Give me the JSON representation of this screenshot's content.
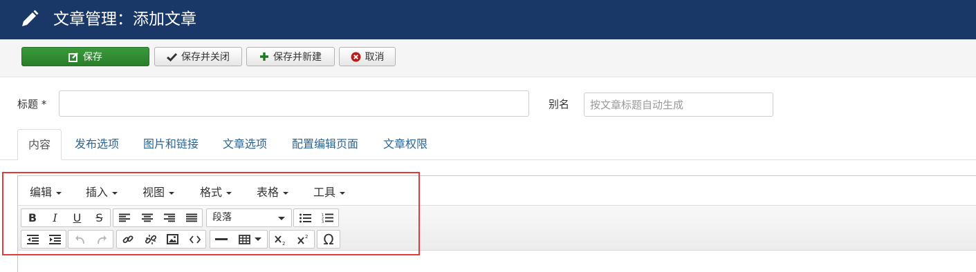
{
  "header": {
    "title": "文章管理：添加文章"
  },
  "toolbar": {
    "save": "保存",
    "save_close": "保存并关闭",
    "save_new": "保存并新建",
    "cancel": "取消"
  },
  "form": {
    "title_label": "标题 *",
    "title_value": "",
    "alias_label": "别名",
    "alias_placeholder": "按文章标题自动生成"
  },
  "tabs": [
    "内容",
    "发布选项",
    "图片和链接",
    "文章选项",
    "配置编辑页面",
    "文章权限"
  ],
  "editor": {
    "menus": [
      "编辑",
      "插入",
      "视图",
      "格式",
      "表格",
      "工具"
    ],
    "format_select": "段落"
  },
  "colors": {
    "header_bg": "#1a3867",
    "save_green": "#2f8a2f",
    "tab_link": "#2a6496",
    "highlight": "#e23a3a"
  }
}
